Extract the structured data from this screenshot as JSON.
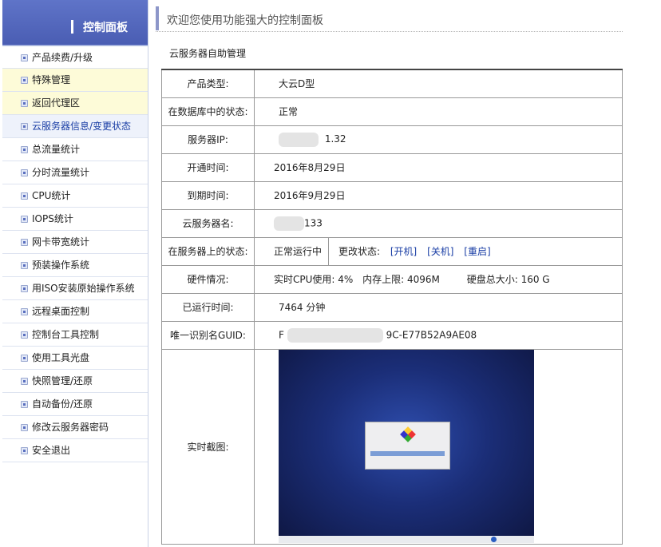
{
  "sidebar": {
    "title": "控制面板",
    "items": [
      {
        "label": "产品续费/升级"
      },
      {
        "label": "特殊管理"
      },
      {
        "label": "返回代理区"
      },
      {
        "label": "云服务器信息/变更状态"
      },
      {
        "label": "总流量统计"
      },
      {
        "label": "分时流量统计"
      },
      {
        "label": "CPU统计"
      },
      {
        "label": "IOPS统计"
      },
      {
        "label": "网卡带宽统计"
      },
      {
        "label": "预装操作系统"
      },
      {
        "label": "用ISO安装原始操作系统"
      },
      {
        "label": "远程桌面控制"
      },
      {
        "label": "控制台工具控制"
      },
      {
        "label": "使用工具光盘"
      },
      {
        "label": "快照管理/还原"
      },
      {
        "label": "自动备份/还原"
      },
      {
        "label": "修改云服务器密码"
      },
      {
        "label": "安全退出"
      }
    ]
  },
  "header": {
    "title": "欢迎您使用功能强大的控制面板"
  },
  "section": {
    "title": "云服务器自助管理"
  },
  "info": {
    "product_type_label": "产品类型:",
    "product_type_value": "大云D型",
    "db_status_label": "在数据库中的状态:",
    "db_status_value": "正常",
    "ip_label": "服务器IP:",
    "ip_value": "1.32",
    "open_time_label": "开通时间:",
    "open_time_value": "2016年8月29日",
    "expire_label": "到期时间:",
    "expire_value": "2016年9月29日",
    "server_name_label": "云服务器名:",
    "server_name_value": "133",
    "server_status_label": "在服务器上的状态:",
    "server_status_value": "正常运行中",
    "change_status_label": "更改状态:",
    "start_link": "[开机]",
    "stop_link": "[关机]",
    "restart_link": "[重启]",
    "hardware_label": "硬件情况:",
    "cpu_usage": "实时CPU使用: 4%",
    "mem_limit": "内存上限: 4096M",
    "disk_size": "硬盘总大小: 160 G",
    "uptime_label": "已运行时间:",
    "uptime_value": "7464 分钟",
    "guid_label": "唯一识别名GUID:",
    "guid_prefix": "F",
    "guid_suffix": "9C-E77B52A9AE08",
    "screenshot_label": "实时截图:"
  },
  "colors": {
    "sidebar_header": "#4a5db3",
    "link": "#1a3ea5",
    "highlight": "#fdfbd8"
  }
}
